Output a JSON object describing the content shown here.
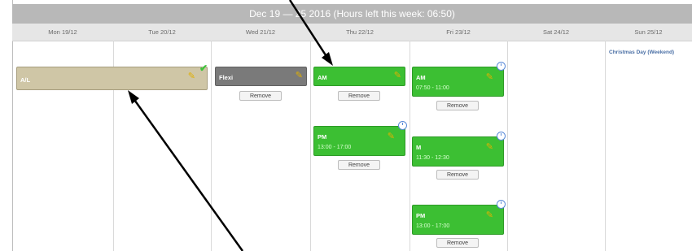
{
  "header": {
    "title": "Dec 19 — 25 2016 (Hours left this week: 06:50)"
  },
  "days": [
    "Mon 19/12",
    "Tue 20/12",
    "Wed 21/12",
    "Thu 22/12",
    "Fri 23/12",
    "Sat 24/12",
    "Sun 25/12"
  ],
  "holiday": "Christmas Day (Weekend)",
  "entries": {
    "al": {
      "label": "A/L"
    },
    "flexi": {
      "label": "Flexi",
      "remove": "Remove"
    },
    "thu_am": {
      "label": "AM",
      "remove": "Remove"
    },
    "thu_pm": {
      "label": "PM",
      "time": "13:00 - 17:00",
      "remove": "Remove"
    },
    "fri_am": {
      "label": "AM",
      "time": "07:50 - 11:00",
      "remove": "Remove"
    },
    "fri_m": {
      "label": "M",
      "time": "11:30 - 12:30",
      "remove": "Remove"
    },
    "fri_pm": {
      "label": "PM",
      "time": "13:00 - 17:00",
      "remove": "Remove"
    }
  },
  "colors": {
    "green": "#3cbf33",
    "al": "#cfc6a6",
    "flexi": "#7a7a7a",
    "header": "#b8b8b8"
  }
}
